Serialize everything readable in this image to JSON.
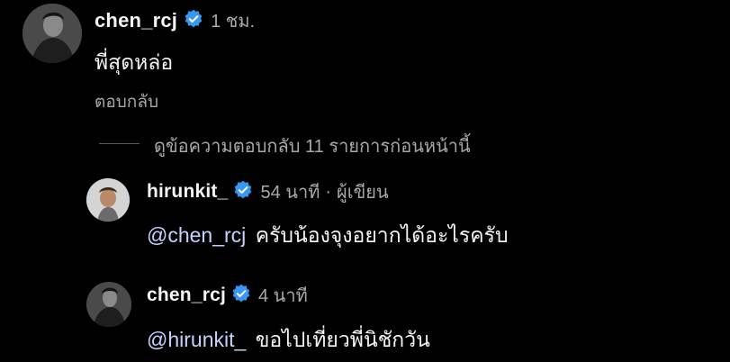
{
  "comment": {
    "username": "chen_rcj",
    "time": "1 ชม.",
    "text": "พี่สุดหล่อ",
    "reply_label": "ตอบกลับ"
  },
  "view_more": {
    "label": "ดูข้อความตอบกลับ 11 รายการก่อนหน้านี้"
  },
  "replies": [
    {
      "username": "hirunkit_",
      "time": "54 นาที",
      "separator": "·",
      "role": "ผู้เขียน",
      "mention": "@chen_rcj",
      "text": "ครับน้องจุงอยากได้อะไรครับ"
    },
    {
      "username": "chen_rcj",
      "time": "4 นาที",
      "mention": "@hirunkit_",
      "text": "ขอไปเที่ยวพี่นิชักวัน"
    }
  ],
  "colors": {
    "background": "#000000",
    "verified": "#3897f0",
    "mention": "#c5d3ff",
    "muted": "#a8a8a8"
  }
}
